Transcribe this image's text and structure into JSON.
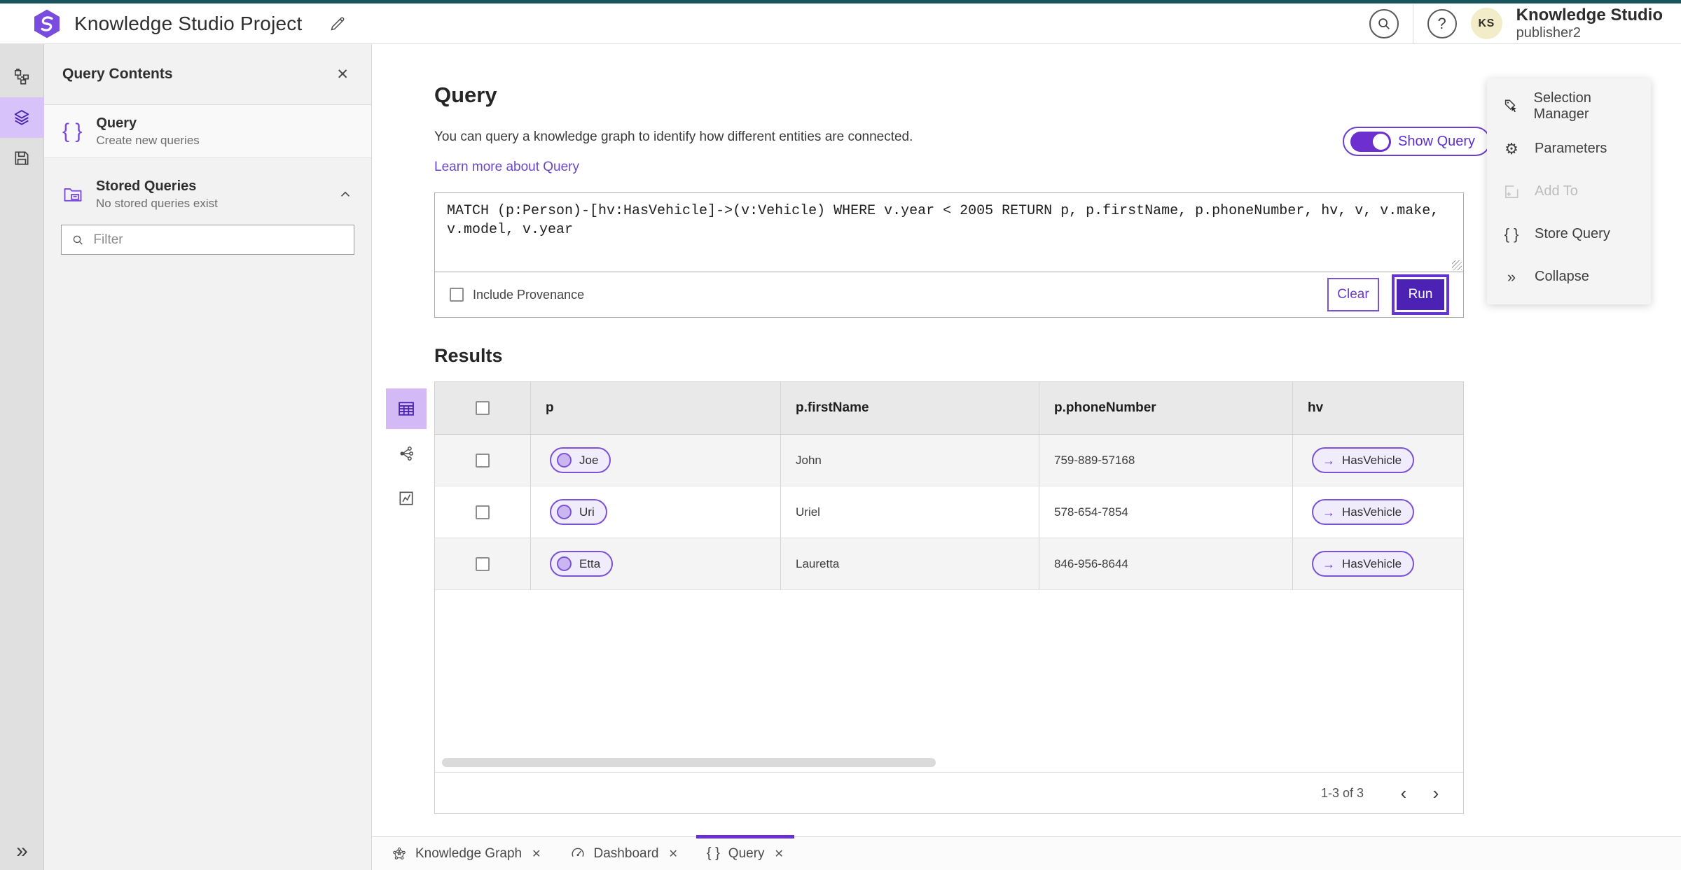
{
  "header": {
    "title": "Knowledge Studio Project",
    "product": "Knowledge Studio",
    "user": "publisher2",
    "avatar_initials": "KS"
  },
  "contents_panel": {
    "title": "Query Contents",
    "query_item": {
      "title": "Query",
      "subtitle": "Create new queries"
    },
    "stored_queries": {
      "title": "Stored Queries",
      "subtitle": "No stored queries exist"
    },
    "filter_placeholder": "Filter"
  },
  "query_section": {
    "title": "Query",
    "description": "You can query a knowledge graph to identify how different entities are connected.",
    "learn_more": "Learn more about Query",
    "show_query_label": "Show Query",
    "query_text": "MATCH (p:Person)-[hv:HasVehicle]->(v:Vehicle) WHERE v.year < 2005 RETURN p, p.firstName, p.phoneNumber, hv, v, v.make, v.model, v.year",
    "include_provenance_label": "Include Provenance",
    "clear_label": "Clear",
    "run_label": "Run"
  },
  "results": {
    "title": "Results",
    "columns": [
      "p",
      "p.firstName",
      "p.phoneNumber",
      "hv"
    ],
    "rows": [
      {
        "p": "Joe",
        "firstName": "John",
        "phoneNumber": "759-889-57168",
        "hv": "HasVehicle"
      },
      {
        "p": "Uri",
        "firstName": "Uriel",
        "phoneNumber": "578-654-7854",
        "hv": "HasVehicle"
      },
      {
        "p": "Etta",
        "firstName": "Lauretta",
        "phoneNumber": "846-956-8644",
        "hv": "HasVehicle"
      }
    ],
    "pagination": {
      "label": "1-3 of 3"
    }
  },
  "side_panel": {
    "items": [
      {
        "label": "Selection Manager",
        "disabled": false
      },
      {
        "label": "Parameters",
        "disabled": false
      },
      {
        "label": "Add To",
        "disabled": true
      },
      {
        "label": "Store Query",
        "disabled": false
      },
      {
        "label": "Collapse",
        "disabled": false
      }
    ]
  },
  "tabs": [
    {
      "label": "Knowledge Graph",
      "active": false
    },
    {
      "label": "Dashboard",
      "active": false
    },
    {
      "label": "Query",
      "active": true
    }
  ],
  "icons": {
    "close": "✕",
    "help": "?",
    "braces": "{ }",
    "collapse_double_chevron": "»",
    "expand_double_chevron": "»",
    "gear": "⚙",
    "edge_arrow": "→",
    "prev_chevron": "‹",
    "next_chevron": "›"
  },
  "colors": {
    "accent_purple": "#6535d2",
    "run_button": "#4c22b5",
    "toggle_on": "#6d2fd0",
    "top_bar_teal": "#18535e",
    "rail_active_bg": "#d8c2fa",
    "pill_bg": "#f1ecfc",
    "pill_border": "#7a52d6",
    "avatar_bg": "#f2edc8",
    "table_header_bg": "#e9e9e9",
    "row_stripe": "#f4f4f4"
  }
}
